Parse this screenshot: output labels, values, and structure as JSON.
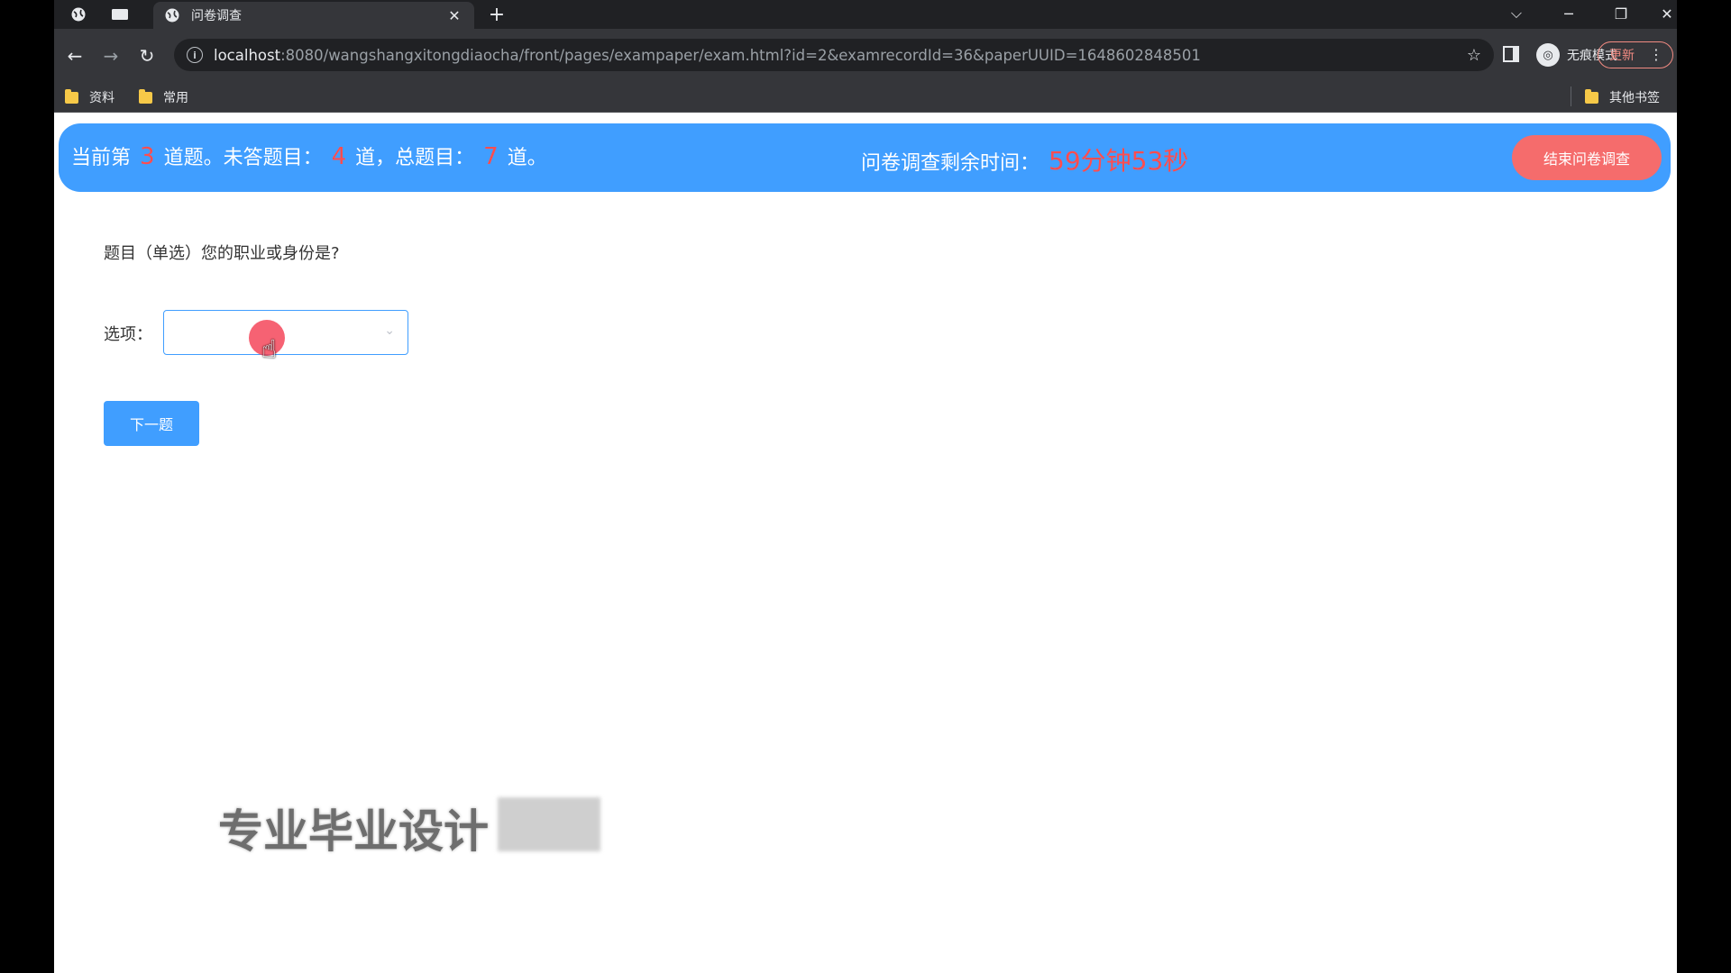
{
  "browser": {
    "tab_title": "问卷调查",
    "new_tab_label": "+",
    "url_host": "localhost",
    "url_rest": ":8080/wangshangxitongdiaocha/front/pages/exampaper/exam.html?id=2&examrecordId=36&paperUUID=1648602848501",
    "incognito_label": "无痕模式",
    "update_label": "更新",
    "bookmarks": [
      "资料",
      "常用"
    ],
    "other_bookmarks": "其他书签"
  },
  "status": {
    "prefix": "当前第",
    "current": "3",
    "mid1": "道题。未答题目：",
    "unanswered": "4",
    "mid2": "道，总题目：",
    "total": "7",
    "suffix": "道。",
    "timer_label": "问卷调查剩余时间：",
    "timer_value": "59分钟53秒",
    "end_button": "结束问卷调查"
  },
  "question": {
    "text": "题目（单选）您的职业或身份是?",
    "option_label": "选项：",
    "select_value": "",
    "next_button": "下一题"
  },
  "watermark": "专业毕业设计"
}
